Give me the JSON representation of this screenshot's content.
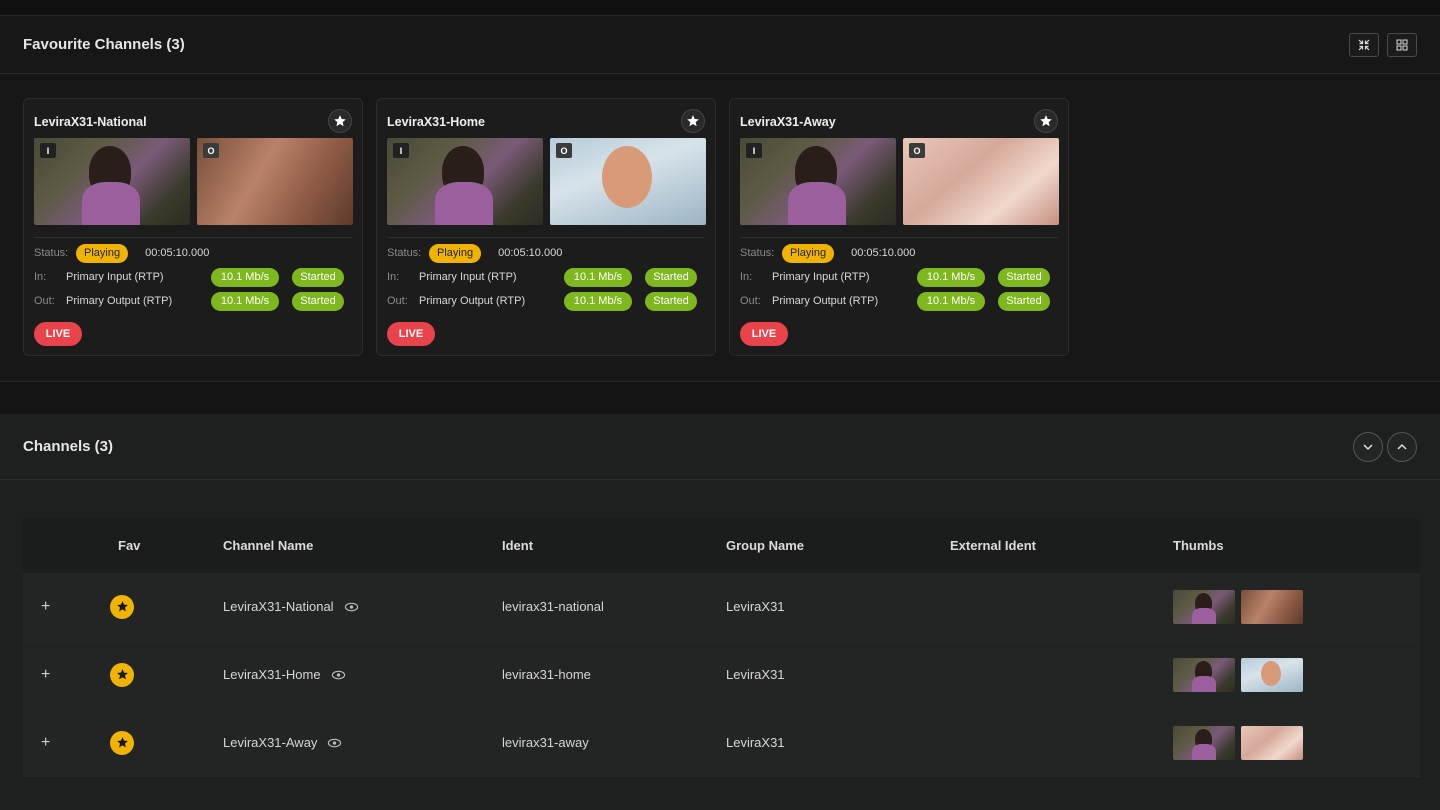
{
  "favourites": {
    "title": "Favourite Channels (3)",
    "cards": [
      {
        "name": "LeviraX31-National",
        "in_badge": "I",
        "out_badge": "O",
        "out_thumb": "th-out1",
        "status_label": "Status:",
        "status": "Playing",
        "time": "00:05:10.000",
        "in_label": "In:",
        "in_name": "Primary Input (RTP)",
        "in_rate": "10.1 Mb/s",
        "in_state": "Started",
        "out_label": "Out:",
        "out_name": "Primary Output (RTP)",
        "out_rate": "10.1 Mb/s",
        "out_state": "Started",
        "live": "LIVE"
      },
      {
        "name": "LeviraX31-Home",
        "in_badge": "I",
        "out_badge": "O",
        "out_thumb": "th-out2",
        "status_label": "Status:",
        "status": "Playing",
        "time": "00:05:10.000",
        "in_label": "In:",
        "in_name": "Primary Input (RTP)",
        "in_rate": "10.1 Mb/s",
        "in_state": "Started",
        "out_label": "Out:",
        "out_name": "Primary Output (RTP)",
        "out_rate": "10.1 Mb/s",
        "out_state": "Started",
        "live": "LIVE"
      },
      {
        "name": "LeviraX31-Away",
        "in_badge": "I",
        "out_badge": "O",
        "out_thumb": "th-out3",
        "status_label": "Status:",
        "status": "Playing",
        "time": "00:05:10.000",
        "in_label": "In:",
        "in_name": "Primary Input (RTP)",
        "in_rate": "10.1 Mb/s",
        "in_state": "Started",
        "out_label": "Out:",
        "out_name": "Primary Output (RTP)",
        "out_rate": "10.1 Mb/s",
        "out_state": "Started",
        "live": "LIVE"
      }
    ]
  },
  "channels": {
    "title": "Channels (3)",
    "columns": {
      "fav": "Fav",
      "name": "Channel Name",
      "ident": "Ident",
      "group": "Group Name",
      "external": "External Ident",
      "thumbs": "Thumbs"
    },
    "rows": [
      {
        "name": "LeviraX31-National",
        "ident": "levirax31-national",
        "group": "LeviraX31",
        "external": "",
        "out_thumb": "th-out1"
      },
      {
        "name": "LeviraX31-Home",
        "ident": "levirax31-home",
        "group": "LeviraX31",
        "external": "",
        "out_thumb": "th-out2"
      },
      {
        "name": "LeviraX31-Away",
        "ident": "levirax31-away",
        "group": "LeviraX31",
        "external": "",
        "out_thumb": "th-out3"
      }
    ],
    "expand_symbol": "+"
  },
  "colors": {
    "accent_yellow": "#f0b400",
    "started_green": "#7fb81e",
    "live_red": "#e9434c",
    "background": "#141414"
  },
  "icons": {
    "fullscreen": "collapse-icon",
    "grid": "grid-icon",
    "star": "star-icon",
    "eye": "eye-icon",
    "chevron_down": "chevron-down-icon",
    "chevron_up": "chevron-up-icon"
  }
}
